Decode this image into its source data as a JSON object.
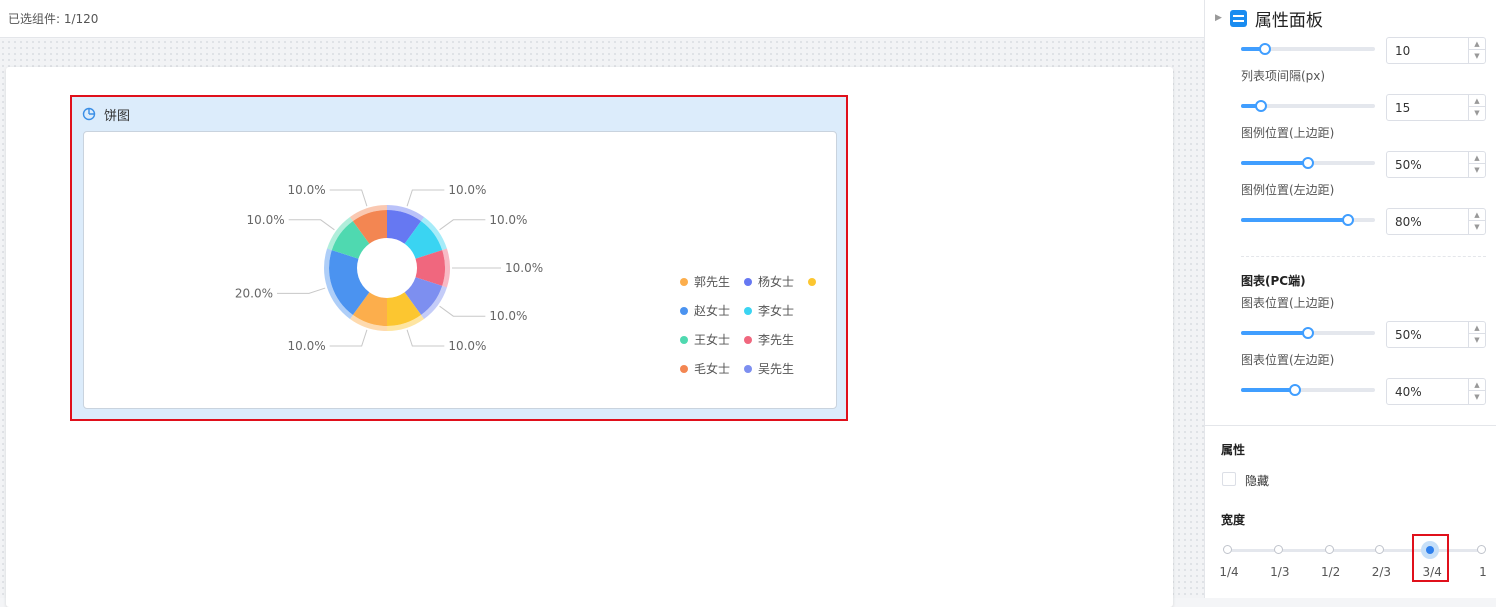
{
  "topbar": {
    "selected_text": "已选组件:  1/120"
  },
  "widget": {
    "title": "饼图",
    "chart_data": {
      "type": "pie",
      "title": "",
      "slices": [
        {
          "name": "杨女士",
          "value": 10,
          "label": "10.0%",
          "color": "#6678f2"
        },
        {
          "name": "李女士",
          "value": 10,
          "label": "10.0%",
          "color": "#3ad4f2"
        },
        {
          "name": "李先生",
          "value": 10,
          "label": "10.0%",
          "color": "#f0677e"
        },
        {
          "name": "吴先生",
          "value": 10,
          "label": "10.0%",
          "color": "#7d8ff0"
        },
        {
          "name": "",
          "value": 10,
          "label": "10.0%",
          "color": "#fcc630"
        },
        {
          "name": "郭先生",
          "value": 10,
          "label": "10.0%",
          "color": "#fcae4c"
        },
        {
          "name": "赵女士",
          "value": 20,
          "label": "20.0%",
          "color": "#4b93f0"
        },
        {
          "name": "王女士",
          "value": 10,
          "label": "10.0%",
          "color": "#4fd9b0"
        },
        {
          "name": "毛女士",
          "value": 10,
          "label": "10.0%",
          "color": "#f38652"
        }
      ],
      "legend": [
        [
          {
            "name": "郭先生",
            "color": "#fcae4c"
          },
          {
            "name": "杨女士",
            "color": "#6678f2"
          },
          {
            "name": "",
            "color": "#fcc630"
          }
        ],
        [
          {
            "name": "赵女士",
            "color": "#4b93f0"
          },
          {
            "name": "李女士",
            "color": "#3ad4f2"
          }
        ],
        [
          {
            "name": "王女士",
            "color": "#4fd9b0"
          },
          {
            "name": "李先生",
            "color": "#f0677e"
          }
        ],
        [
          {
            "name": "毛女士",
            "color": "#f38652"
          },
          {
            "name": "吴先生",
            "color": "#7d8ff0"
          }
        ]
      ],
      "legend_placement": "right",
      "inner_radius_ratio": 0.5
    }
  },
  "panel": {
    "title": "属性面板",
    "rows": [
      {
        "label": "",
        "value": "10",
        "level": 0.18
      },
      {
        "label": "列表项间隔(px)",
        "value": "15",
        "level": 0.15
      },
      {
        "label": "图例位置(上边距)",
        "value": "50%",
        "level": 0.5
      },
      {
        "label": "图例位置(左边距)",
        "value": "80%",
        "level": 0.8
      }
    ],
    "pc_section_title": "图表(PC端)",
    "pc_rows": [
      {
        "label": "图表位置(上边距)",
        "value": "50%",
        "level": 0.5
      },
      {
        "label": "图表位置(左边距)",
        "value": "40%",
        "level": 0.4
      }
    ],
    "attr_title": "属性",
    "hidden_label": "隐藏",
    "width_title": "宽度",
    "width_steps": [
      "1/4",
      "1/3",
      "1/2",
      "2/3",
      "3/4",
      "1"
    ],
    "width_selected": "3/4"
  }
}
